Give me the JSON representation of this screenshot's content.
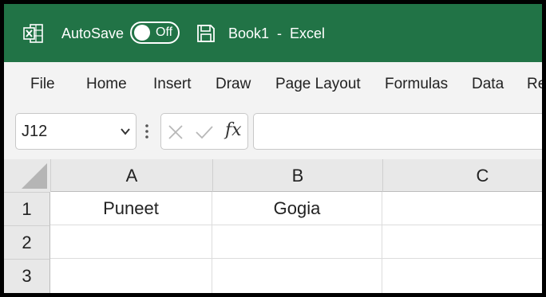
{
  "titlebar": {
    "autosave_label": "AutoSave",
    "autosave_state": "Off",
    "document_title": "Book1  -  Excel",
    "colors": {
      "background": "#217346",
      "text": "#ffffff"
    }
  },
  "ribbon": {
    "tabs": [
      "File",
      "Home",
      "Insert",
      "Draw",
      "Page Layout",
      "Formulas",
      "Data",
      "Re"
    ]
  },
  "formula_bar": {
    "name_box": "J12",
    "fx_label": "fx",
    "formula_value": ""
  },
  "grid": {
    "columns": [
      "A",
      "B",
      "C"
    ],
    "rows": [
      {
        "header": "1",
        "cells": [
          "Puneet",
          "Gogia",
          ""
        ]
      },
      {
        "header": "2",
        "cells": [
          "",
          "",
          ""
        ]
      },
      {
        "header": "3",
        "cells": [
          "",
          "",
          ""
        ]
      }
    ]
  }
}
